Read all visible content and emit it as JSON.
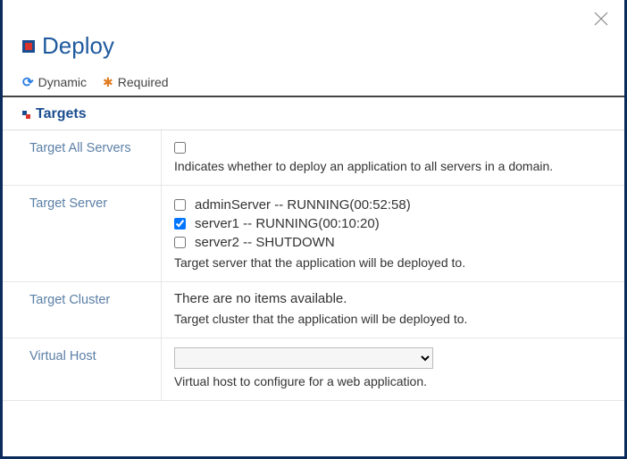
{
  "header": {
    "title": "Deploy"
  },
  "legend": {
    "dynamic": "Dynamic",
    "required": "Required"
  },
  "section": {
    "title": "Targets"
  },
  "fields": {
    "targetAll": {
      "label": "Target All Servers",
      "help": "Indicates whether to deploy an application to all servers in a domain."
    },
    "targetServer": {
      "label": "Target Server",
      "options": [
        {
          "text": "adminServer -- RUNNING(00:52:58)",
          "checked": false
        },
        {
          "text": "server1 -- RUNNING(00:10:20)",
          "checked": true
        },
        {
          "text": "server2 -- SHUTDOWN",
          "checked": false
        }
      ],
      "help": "Target server that the application will be deployed to."
    },
    "targetCluster": {
      "label": "Target Cluster",
      "empty": "There are no items available.",
      "help": "Target cluster that the application will be deployed to."
    },
    "virtualHost": {
      "label": "Virtual Host",
      "selected": "",
      "help": "Virtual host to configure for a web application."
    }
  }
}
